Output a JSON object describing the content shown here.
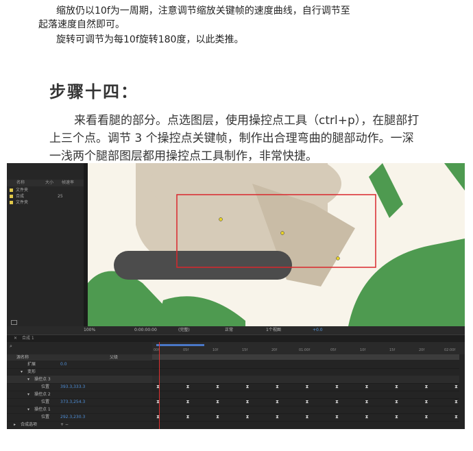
{
  "document": {
    "para1_line1": "缩放仍以10f为一周期，注意调节缩放关键帧的速度曲线，自行调节至",
    "para1_line2": "起落速度自然即可。",
    "para2": "旋转可调节为每10f旋转180度，以此类推。",
    "heading": "步骤十四：",
    "body": "来看看腿的部分。点选图层，使用操控点工具（ctrl+p），在腿部打上三个点。调节 3 个操控点关键帧，制作出合理弯曲的腿部动作。一深一浅两个腿部图层都用操控点工具制作，非常快捷。"
  },
  "project_panel": {
    "header_name": "名称",
    "header_size": "大小",
    "header_rate": "帧速率",
    "items": [
      {
        "name": "文件夹",
        "size": ""
      },
      {
        "name": "合成",
        "size": "25"
      },
      {
        "name": "文件夹",
        "size": ""
      }
    ]
  },
  "viewer_bar": {
    "zoom": "100%",
    "timecode": "0:00:00:00",
    "resolution": "(完整)",
    "mode": "正常",
    "view": "1个视图",
    "exposure": "+0.0"
  },
  "timeline": {
    "tab": "合成 1",
    "header_layer": "源名称",
    "header_switches": "父级",
    "ruler_labels": [
      "00f",
      "05f",
      "10f",
      "15f",
      "20f",
      "01:00f",
      "05f",
      "10f",
      "15f",
      "20f",
      "02:00f"
    ],
    "layers": [
      {
        "name": "扩展",
        "value": "0.0"
      },
      {
        "name": "变形",
        "value": ""
      },
      {
        "name": "操控点 3",
        "value": ""
      },
      {
        "name": "位置",
        "value": "393.3,333.3"
      },
      {
        "name": "操控点 2",
        "value": ""
      },
      {
        "name": "位置",
        "value": "373.3,254.3"
      },
      {
        "name": "操控点 1",
        "value": ""
      },
      {
        "name": "位置",
        "value": "292.3,230.3"
      },
      {
        "name": "合成选项",
        "value": "+ −"
      }
    ],
    "keyframe_glyph": "⧗"
  },
  "colors": {
    "panel_bg": "#232323",
    "canvas_bg": "#f8f4ea",
    "beige": "#d6cbb8",
    "green": "#4e9a50",
    "dark_gray": "#4c4c4c",
    "selection_red": "#d9262c",
    "playhead": "#e03030",
    "value_blue": "#4f8fd8"
  }
}
